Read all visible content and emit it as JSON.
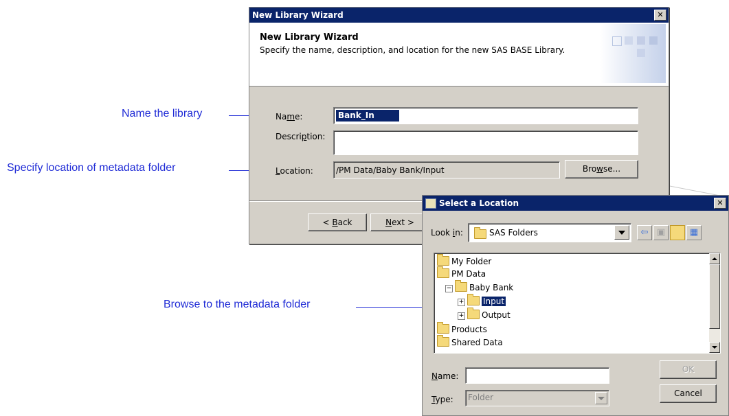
{
  "annotations": {
    "name_library": "Name the library",
    "specify_location": "Specify location of metadata folder",
    "browse_folder": "Browse to the metadata folder"
  },
  "wizard": {
    "title": "New Library Wizard",
    "header_title": "New Library Wizard",
    "header_desc": "Specify the name, description, and location for the new SAS BASE Library.",
    "name_label_pre": "Na",
    "name_label_u": "m",
    "name_label_post": "e:",
    "name_value": "Bank_In",
    "desc_label_pre": "Descri",
    "desc_label_u": "p",
    "desc_label_post": "tion:",
    "desc_value": "",
    "loc_label_u": "L",
    "loc_label_post": "ocation:",
    "loc_value": "/PM Data/Baby Bank/Input",
    "browse_pre": "Bro",
    "browse_u": "w",
    "browse_post": "se...",
    "back_pre": "< ",
    "back_u": "B",
    "back_post": "ack",
    "next_u": "N",
    "next_post": "ext >"
  },
  "dialog": {
    "title": "Select a Location",
    "lookin_pre": "Look ",
    "lookin_u": "i",
    "lookin_post": "n:",
    "lookin_value": "SAS Folders",
    "tree": [
      {
        "label": "My Folder"
      },
      {
        "label": "PM Data"
      },
      {
        "label": "Baby Bank"
      },
      {
        "label": "Input"
      },
      {
        "label": "Output"
      },
      {
        "label": "Products"
      },
      {
        "label": "Shared Data"
      }
    ],
    "name_label_u": "N",
    "name_label_post": "ame:",
    "name_value": "",
    "type_label_u": "T",
    "type_label_post": "ype:",
    "type_value": "Folder",
    "ok_label": "OK",
    "cancel_label": "Cancel"
  },
  "colors": {
    "titlebar": "#0a246a",
    "annotation": "#1f2bd6",
    "window_face": "#d4d0c8"
  }
}
